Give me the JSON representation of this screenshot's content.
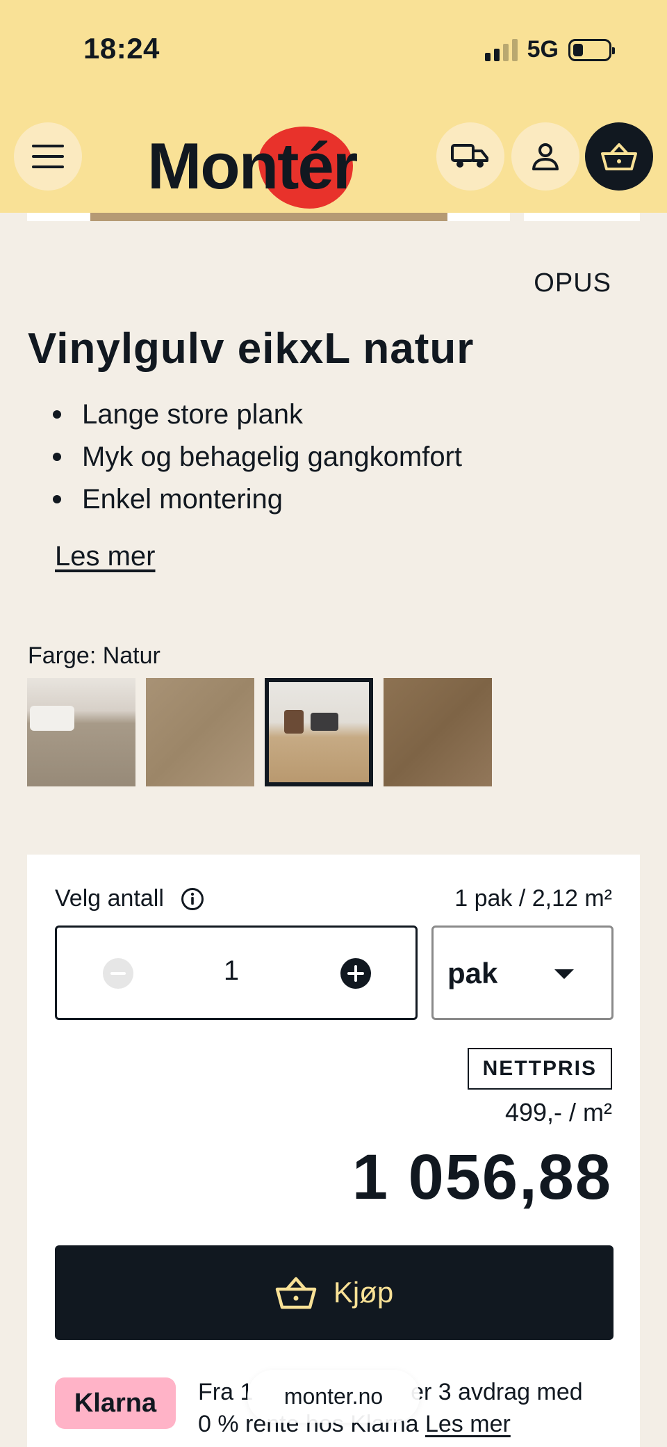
{
  "status_bar": {
    "time": "18:24",
    "network": "5G"
  },
  "header": {
    "logo_text": "Montér",
    "accent_color": "#e8322b",
    "background_color": "#f9e196",
    "icons": [
      "hamburger-menu-icon",
      "truck-icon",
      "user-icon",
      "basket-icon"
    ]
  },
  "product": {
    "brand": "OPUS",
    "title": "Vinylgulv eikxL natur",
    "features": [
      "Lange store plank",
      "Myk og behagelig gangkomfort",
      "Enkel montering"
    ],
    "read_more": "Les mer",
    "color_label": "Farge: Natur"
  },
  "purchase": {
    "qty_label": "Velg antall",
    "pack_info": "1 pak / 2,12 m²",
    "quantity": "1",
    "unit": "pak",
    "badge": "NETTPRIS",
    "unit_price": "499,- / m²",
    "total_price": "1 056,88",
    "buy_label": "Kjøp"
  },
  "klarna": {
    "badge": "Klarna",
    "text": "Fra 1… rente hos Klarna",
    "line1": "Fra 1",
    "line1_end": "er 3 avdrag med",
    "line2": "0 % rente hos Klarna",
    "link": "Les mer"
  },
  "browser": {
    "url": "monter.no"
  }
}
